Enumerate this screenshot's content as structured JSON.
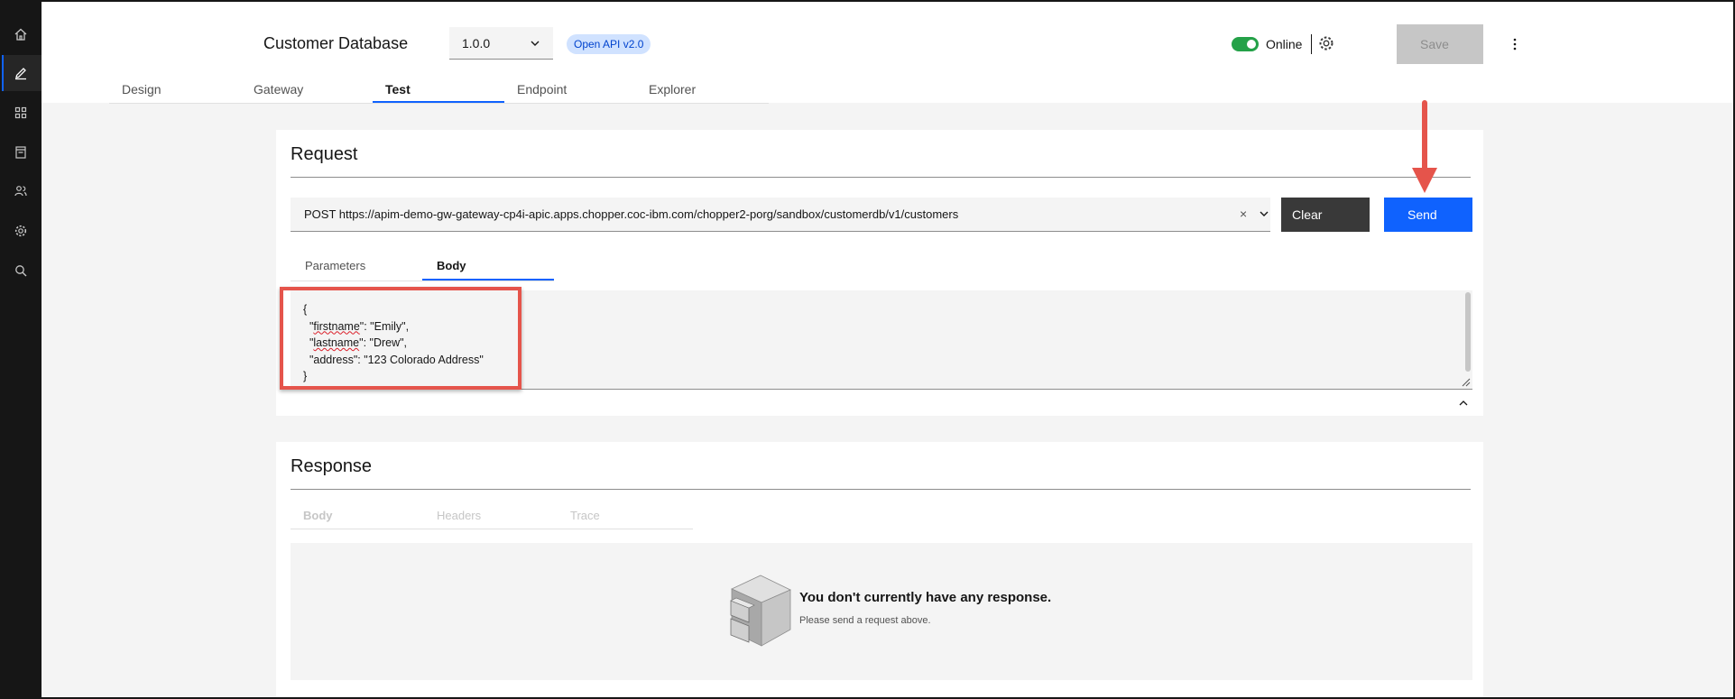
{
  "sidebar": {
    "items": [
      {
        "icon": "home-icon",
        "active": false
      },
      {
        "icon": "edit-icon",
        "active": true
      },
      {
        "icon": "apps-icon",
        "active": false
      },
      {
        "icon": "catalog-icon",
        "active": false
      },
      {
        "icon": "users-icon",
        "active": false
      },
      {
        "icon": "settings-icon",
        "active": false
      },
      {
        "icon": "search-icon",
        "active": false
      }
    ]
  },
  "header": {
    "title": "Customer Database",
    "version": "1.0.0",
    "api_tag": "Open API v2.0",
    "status_label": "Online",
    "save_label": "Save",
    "tabs": [
      {
        "label": "Design"
      },
      {
        "label": "Gateway"
      },
      {
        "label": "Test",
        "active": true
      },
      {
        "label": "Endpoint"
      },
      {
        "label": "Explorer"
      }
    ]
  },
  "request": {
    "title": "Request",
    "url": "POST https://apim-demo-gw-gateway-cp4i-apic.apps.chopper.coc-ibm.com/chopper2-porg/sandbox/customerdb/v1/customers",
    "clear_icon": "×",
    "clear_label": "Clear",
    "send_label": "Send",
    "tabs": [
      {
        "label": "Parameters"
      },
      {
        "label": "Body",
        "active": true
      }
    ],
    "body": {
      "open": "{",
      "firstname_key": "firstname",
      "firstname_value": ": \"Emily\",",
      "lastname_key": "lastname",
      "lastname_value": ": \"Drew\",",
      "address_line": "  \"address\": \"123 Colorado Address\"",
      "close": "}"
    }
  },
  "response": {
    "title": "Response",
    "tabs": [
      {
        "label": "Body"
      },
      {
        "label": "Headers"
      },
      {
        "label": "Trace"
      }
    ],
    "empty_title": "You don't currently have any response.",
    "empty_subtitle": "Please send a request above."
  },
  "colors": {
    "accent": "#0f62fe",
    "status_online": "#24a148",
    "annotation": "#e5544b"
  }
}
